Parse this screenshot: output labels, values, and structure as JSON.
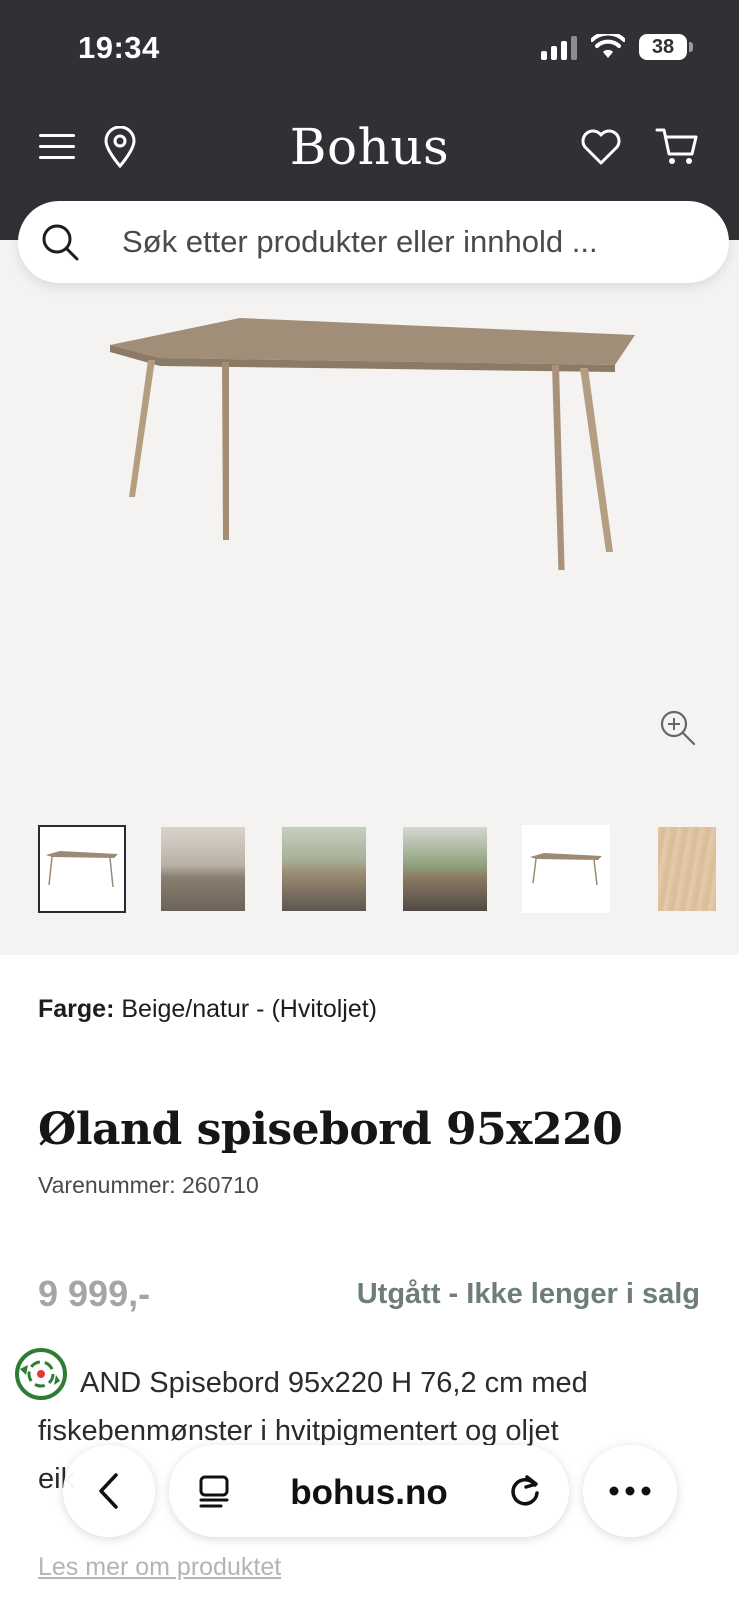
{
  "status_bar": {
    "time": "19:34",
    "battery": "38"
  },
  "header": {
    "logo": "Bohus"
  },
  "search": {
    "placeholder": "Søk etter produkter eller innhold ..."
  },
  "gallery": {
    "thumbnail_count": 6
  },
  "product": {
    "color_label": "Farge:",
    "color_value": "Beige/natur - (Hvitoljet)",
    "title": "Øland spisebord 95x220",
    "sku_label": "Varenummer:",
    "sku": "260710",
    "price": "9 999,-",
    "availability": "Utgått - Ikke lenger i salg",
    "description_line1": "AND Spisebord 95x220 H 76,2 cm med",
    "description_line2": "fiskebenmønster i hvitpigmentert og oljet",
    "description_line3": "eik",
    "read_more": "Les mer om produktet"
  },
  "browser": {
    "url": "bohus.no"
  },
  "colors": {
    "header_bg": "#313035",
    "gallery_bg": "#f5f3f1",
    "status_text": "#6d7e79",
    "price_text": "#a5a5a8"
  }
}
